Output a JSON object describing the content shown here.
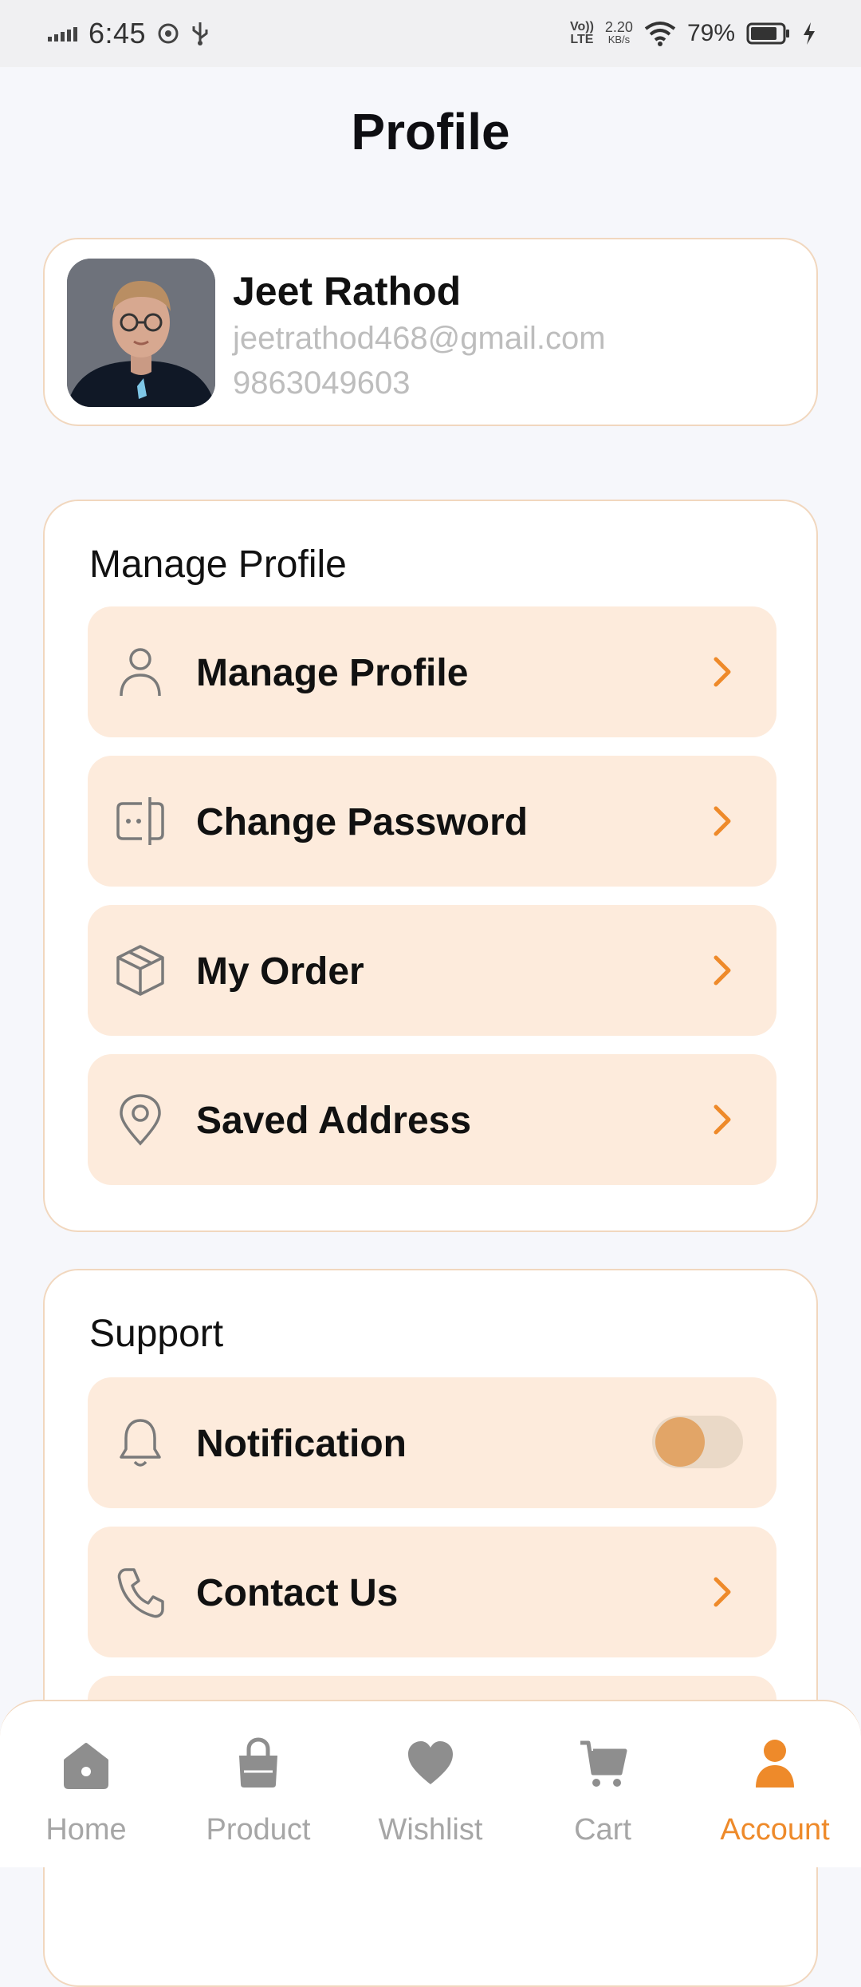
{
  "status_bar": {
    "time": "6:45",
    "net_type_top": "Vo))",
    "net_type_bottom": "LTE",
    "speed_value": "2.20",
    "speed_unit": "KB/s",
    "battery": "79%"
  },
  "page": {
    "title": "Profile"
  },
  "profile": {
    "name": "Jeet Rathod",
    "email": "jeetrathod468@gmail.com",
    "phone": "9863049603"
  },
  "manage_section": {
    "title": "Manage Profile",
    "items": [
      {
        "label": "Manage Profile",
        "icon": "user-icon"
      },
      {
        "label": "Change Password",
        "icon": "password-icon"
      },
      {
        "label": "My Order",
        "icon": "package-icon"
      },
      {
        "label": "Saved Address",
        "icon": "location-pin-icon"
      }
    ]
  },
  "support_section": {
    "title": "Support",
    "items": [
      {
        "label": "Notification",
        "icon": "bell-icon",
        "toggle": false
      },
      {
        "label": "Contact Us",
        "icon": "phone-icon"
      }
    ]
  },
  "bottom_nav": {
    "items": [
      {
        "label": "Home",
        "icon": "home-icon",
        "active": false
      },
      {
        "label": "Product",
        "icon": "shopping-bag-icon",
        "active": false
      },
      {
        "label": "Wishlist",
        "icon": "heart-icon",
        "active": false
      },
      {
        "label": "Cart",
        "icon": "cart-icon",
        "active": false
      },
      {
        "label": "Account",
        "icon": "account-icon",
        "active": true
      }
    ]
  },
  "colors": {
    "accent": "#EE8A2A",
    "row_background": "#FDEBDC",
    "card_border": "#F1D7BE",
    "page_background": "#F6F7FB",
    "muted_text": "#BDBDBD"
  }
}
